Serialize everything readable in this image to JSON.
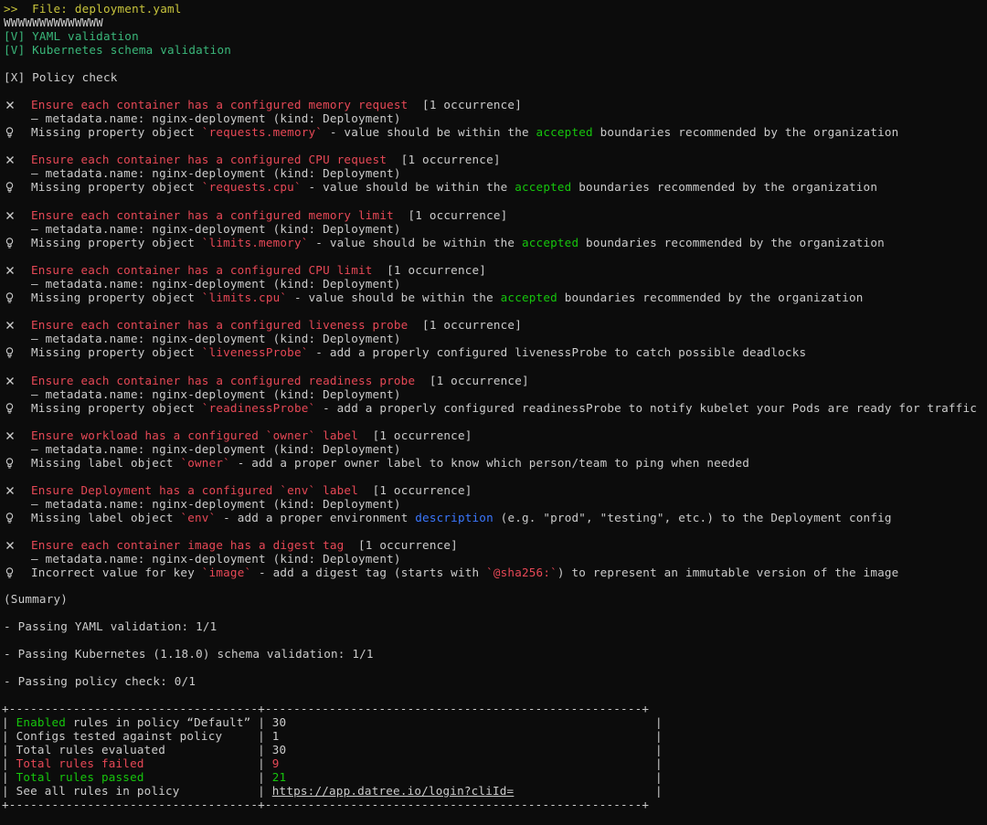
{
  "header": {
    "file_line": ">>  File: deployment.yaml",
    "wave_line": "WWWWWWWWWWWWWW",
    "yaml_validation": "[V] YAML validation",
    "schema_validation": "[V] Kubernetes schema validation",
    "policy_check": "[X] Policy check"
  },
  "rules": [
    {
      "title": "Ensure each container has a configured memory request",
      "count": "[1 occurrence]",
      "meta": "— metadata.name: nginx-deployment (kind: Deployment)",
      "msg_prefix": "Missing property object ",
      "msg_code": "`requests.memory`",
      "msg_mid": " - value should be within the ",
      "msg_hl": "accepted",
      "msg_suffix": " boundaries recommended by the organization"
    },
    {
      "title": "Ensure each container has a configured CPU request",
      "count": "[1 occurrence]",
      "meta": "— metadata.name: nginx-deployment (kind: Deployment)",
      "msg_prefix": "Missing property object ",
      "msg_code": "`requests.cpu`",
      "msg_mid": " - value should be within the ",
      "msg_hl": "accepted",
      "msg_suffix": " boundaries recommended by the organization"
    },
    {
      "title": "Ensure each container has a configured memory limit",
      "count": "[1 occurrence]",
      "meta": "— metadata.name: nginx-deployment (kind: Deployment)",
      "msg_prefix": "Missing property object ",
      "msg_code": "`limits.memory`",
      "msg_mid": " - value should be within the ",
      "msg_hl": "accepted",
      "msg_suffix": " boundaries recommended by the organization"
    },
    {
      "title": "Ensure each container has a configured CPU limit",
      "count": "[1 occurrence]",
      "meta": "— metadata.name: nginx-deployment (kind: Deployment)",
      "msg_prefix": "Missing property object ",
      "msg_code": "`limits.cpu`",
      "msg_mid": " - value should be within the ",
      "msg_hl": "accepted",
      "msg_suffix": " boundaries recommended by the organization"
    },
    {
      "title": "Ensure each container has a configured liveness probe",
      "count": "[1 occurrence]",
      "meta": "— metadata.name: nginx-deployment (kind: Deployment)",
      "msg_prefix": "Missing property object ",
      "msg_code": "`livenessProbe`",
      "msg_mid": " - add a properly configured livenessProbe to catch possible deadlocks",
      "msg_hl": "",
      "msg_suffix": ""
    },
    {
      "title": "Ensure each container has a configured readiness probe",
      "count": "[1 occurrence]",
      "meta": "— metadata.name: nginx-deployment (kind: Deployment)",
      "msg_prefix": "Missing property object ",
      "msg_code": "`readinessProbe`",
      "msg_mid": " - add a properly configured readinessProbe to notify kubelet your Pods are ready for traffic",
      "msg_hl": "",
      "msg_suffix": ""
    },
    {
      "title": "Ensure workload has a configured `owner` label",
      "count": "[1 occurrence]",
      "meta": "— metadata.name: nginx-deployment (kind: Deployment)",
      "msg_prefix": "Missing label object ",
      "msg_code": "`owner`",
      "msg_mid": " - add a proper owner label to know which person/team to ping when needed",
      "msg_hl": "",
      "msg_suffix": ""
    },
    {
      "title": "Ensure Deployment has a configured `env` label",
      "count": "[1 occurrence]",
      "meta": "— metadata.name: nginx-deployment (kind: Deployment)",
      "msg_prefix": "Missing label object ",
      "msg_code": "`env`",
      "msg_mid": " - add a proper environment ",
      "msg_hl": "description",
      "msg_suffix": " (e.g. \"prod\", \"testing\", etc.) to the Deployment config"
    },
    {
      "title": "Ensure each container image has a digest tag",
      "count": "[1 occurrence]",
      "meta": "— metadata.name: nginx-deployment (kind: Deployment)",
      "msg_prefix": "Incorrect value for key ",
      "msg_code": "`image`",
      "msg_mid": " - add a digest tag (starts with ",
      "msg_hl": "`@sha256:`",
      "msg_suffix": ") to represent an immutable version of the image"
    }
  ],
  "summary": {
    "heading": "(Summary)",
    "yaml": "- Passing YAML validation: 1/1",
    "k8s": "- Passing Kubernetes (1.18.0) schema validation: 1/1",
    "policy": "- Passing policy check: 0/1"
  },
  "table": {
    "border": "+-----------------------------------+-----------------------------------------------------+",
    "enabled_word": "Enabled",
    "enabled_rest": " rules in policy “Default”",
    "enabled_value": "30",
    "configs_label": "Configs tested against policy",
    "configs_value": "1",
    "evaluated_label": "Total rules evaluated",
    "evaluated_value": "30",
    "failed_label": "Total rules failed",
    "failed_value": "9",
    "passed_label": "Total rules passed",
    "passed_value": "21",
    "see_all_label": "See all rules in policy",
    "link": "https://app.datree.io/login?cliId="
  },
  "icons": [
    "close-icon",
    "lightbulb-icon"
  ],
  "colors": {
    "background": "#0c0c0c",
    "text": "#cccccc",
    "error": "#e74856",
    "success": "#16c60c",
    "prompt": "#c8c43c",
    "info": "#3b78ff"
  }
}
